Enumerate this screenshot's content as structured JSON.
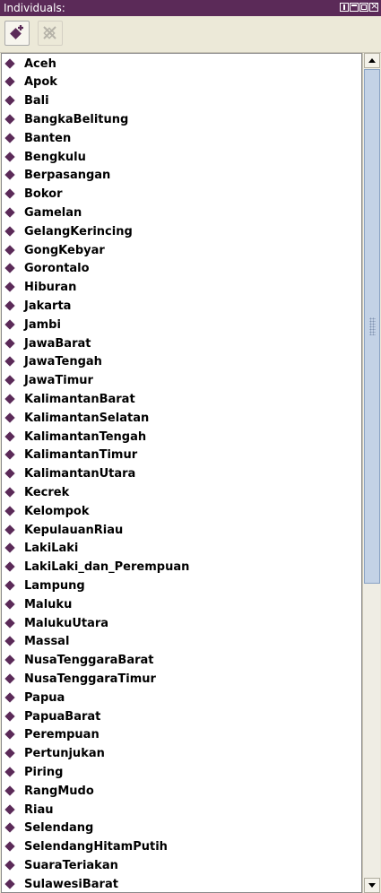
{
  "panel": {
    "title": "Individuals:"
  },
  "toolbar": {
    "add_icon": "add-individual-icon",
    "delete_icon": "delete-individual-icon"
  },
  "colors": {
    "title_bar": "#5b2a58",
    "individual_marker": "#5b2a58",
    "scroll_thumb": "#c3d2e6"
  },
  "individuals": [
    {
      "label": "Aceh"
    },
    {
      "label": "Apok"
    },
    {
      "label": "Bali"
    },
    {
      "label": "BangkaBelitung"
    },
    {
      "label": "Banten"
    },
    {
      "label": "Bengkulu"
    },
    {
      "label": "Berpasangan"
    },
    {
      "label": "Bokor"
    },
    {
      "label": "Gamelan"
    },
    {
      "label": "GelangKerincing"
    },
    {
      "label": "GongKebyar"
    },
    {
      "label": "Gorontalo"
    },
    {
      "label": "Hiburan"
    },
    {
      "label": "Jakarta"
    },
    {
      "label": "Jambi"
    },
    {
      "label": "JawaBarat"
    },
    {
      "label": "JawaTengah"
    },
    {
      "label": "JawaTimur"
    },
    {
      "label": "KalimantanBarat"
    },
    {
      "label": "KalimantanSelatan"
    },
    {
      "label": "KalimantanTengah"
    },
    {
      "label": "KalimantanTimur"
    },
    {
      "label": "KalimantanUtara"
    },
    {
      "label": "Kecrek"
    },
    {
      "label": "Kelompok"
    },
    {
      "label": "KepulauanRiau"
    },
    {
      "label": "LakiLaki"
    },
    {
      "label": "LakiLaki_dan_Perempuan"
    },
    {
      "label": "Lampung"
    },
    {
      "label": "Maluku"
    },
    {
      "label": "MalukuUtara"
    },
    {
      "label": "Massal"
    },
    {
      "label": "NusaTenggaraBarat"
    },
    {
      "label": "NusaTenggaraTimur"
    },
    {
      "label": "Papua"
    },
    {
      "label": "PapuaBarat"
    },
    {
      "label": "Perempuan"
    },
    {
      "label": "Pertunjukan"
    },
    {
      "label": "Piring"
    },
    {
      "label": "RangMudo"
    },
    {
      "label": "Riau"
    },
    {
      "label": "Selendang"
    },
    {
      "label": "SelendangHitamPutih"
    },
    {
      "label": "SuaraTeriakan"
    },
    {
      "label": "SulawesiBarat"
    }
  ]
}
